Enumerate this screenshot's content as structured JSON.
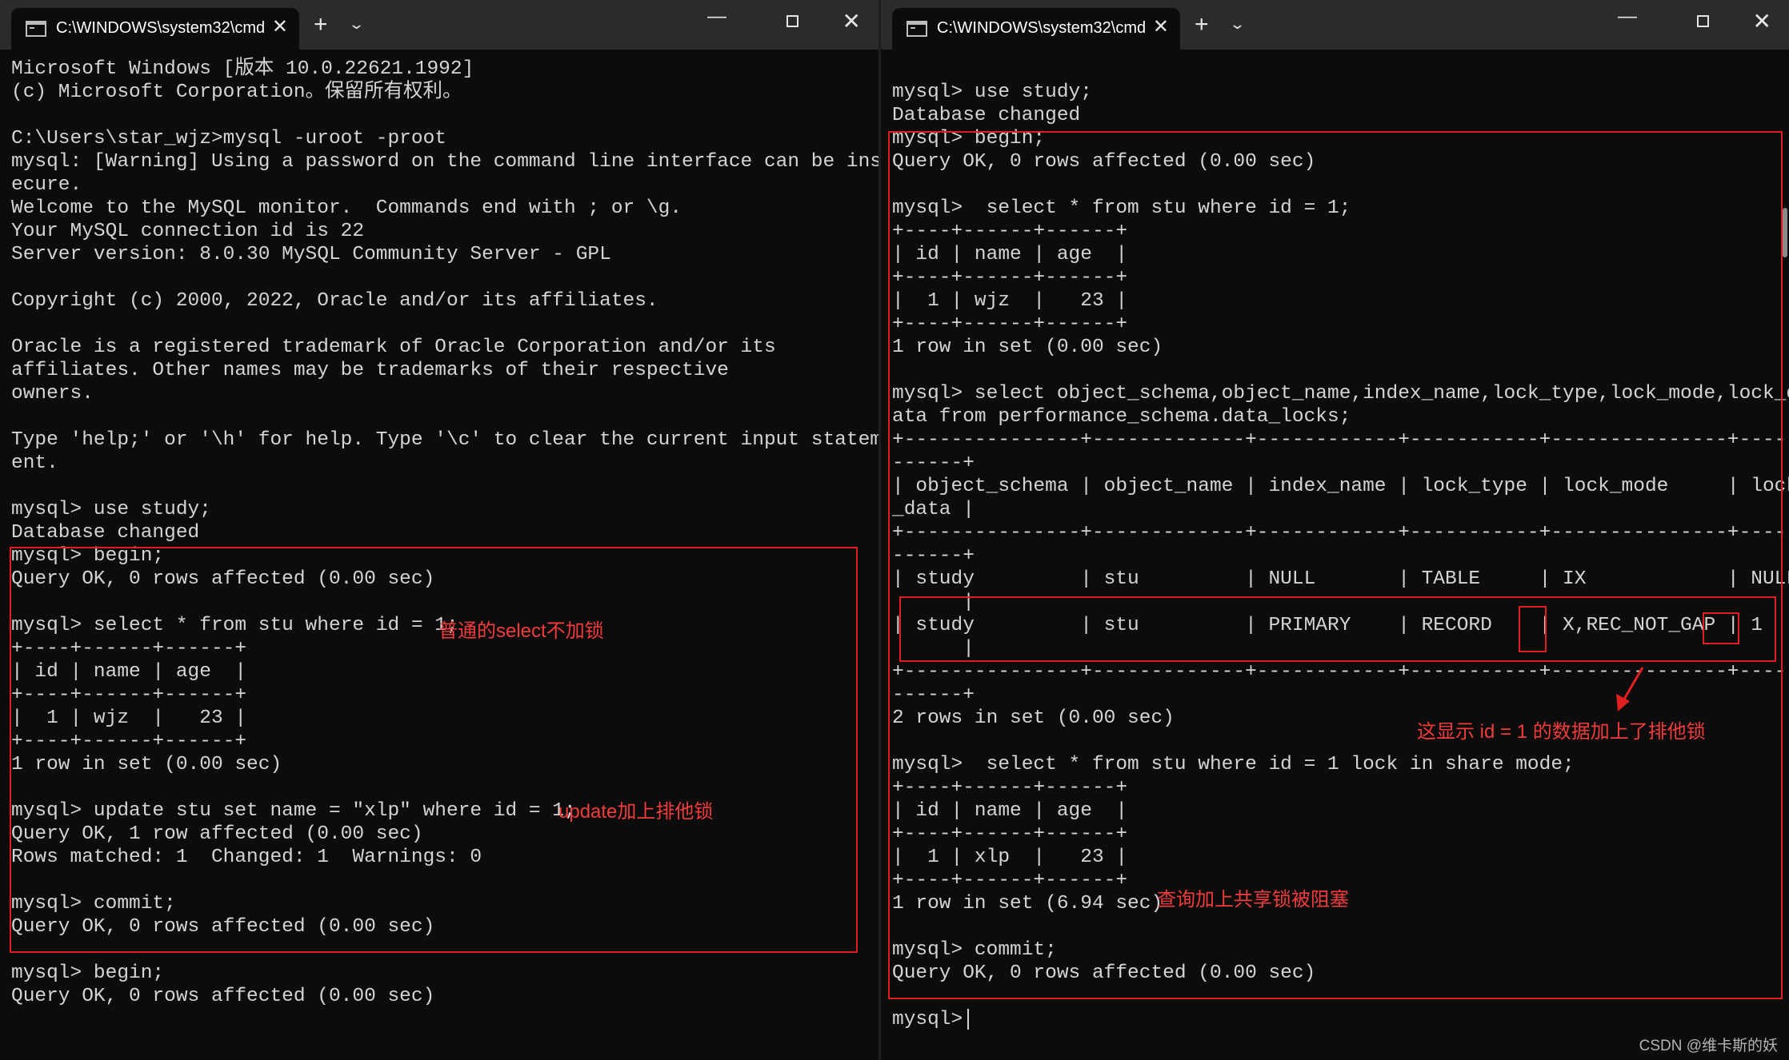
{
  "left_window": {
    "tab_title": "C:\\WINDOWS\\system32\\cmd.",
    "lines": [
      "Microsoft Windows [版本 10.0.22621.1992]",
      "(c) Microsoft Corporation。保留所有权利。",
      "",
      "C:\\Users\\star_wjz>mysql -uroot -proot",
      "mysql: [Warning] Using a password on the command line interface can be ins",
      "ecure.",
      "Welcome to the MySQL monitor.  Commands end with ; or \\g.",
      "Your MySQL connection id is 22",
      "Server version: 8.0.30 MySQL Community Server - GPL",
      "",
      "Copyright (c) 2000, 2022, Oracle and/or its affiliates.",
      "",
      "Oracle is a registered trademark of Oracle Corporation and/or its",
      "affiliates. Other names may be trademarks of their respective",
      "owners.",
      "",
      "Type 'help;' or '\\h' for help. Type '\\c' to clear the current input statem",
      "ent.",
      "",
      "mysql> use study;",
      "Database changed",
      "mysql> begin;",
      "Query OK, 0 rows affected (0.00 sec)",
      "",
      "mysql> select * from stu where id = 1;",
      "+----+------+------+",
      "| id | name | age  |",
      "+----+------+------+",
      "|  1 | wjz  |   23 |",
      "+----+------+------+",
      "1 row in set (0.00 sec)",
      "",
      "mysql> update stu set name = \"xlp\" where id = 1;",
      "Query OK, 1 row affected (0.00 sec)",
      "Rows matched: 1  Changed: 1  Warnings: 0",
      "",
      "mysql> commit;",
      "Query OK, 0 rows affected (0.00 sec)",
      "",
      "mysql> begin;",
      "Query OK, 0 rows affected (0.00 sec)"
    ],
    "annotations": {
      "select_note": "普通的select不加锁",
      "update_note": "update加上排他锁"
    }
  },
  "right_window": {
    "tab_title": "C:\\WINDOWS\\system32\\cmd.",
    "lines": [
      "mysql> use study;",
      "Database changed",
      "mysql> begin;",
      "Query OK, 0 rows affected (0.00 sec)",
      "",
      "mysql>  select * from stu where id = 1;",
      "+----+------+------+",
      "| id | name | age  |",
      "+----+------+------+",
      "|  1 | wjz  |   23 |",
      "+----+------+------+",
      "1 row in set (0.00 sec)",
      "",
      "mysql> select object_schema,object_name,index_name,lock_type,lock_mode,lock_d",
      "ata from performance_schema.data_locks;",
      "+---------------+-------------+------------+-----------+---------------+-----",
      "------+",
      "| object_schema | object_name | index_name | lock_type | lock_mode     | lock",
      "_data |",
      "+---------------+-------------+------------+-----------+---------------+-----",
      "------+",
      "| study         | stu         | NULL       | TABLE     | IX            | NULL",
      "      |",
      "| study         | stu         | PRIMARY    | RECORD    | X,REC_NOT_GAP | 1",
      "      |",
      "+---------------+-------------+------------+-----------+---------------+-----",
      "------+",
      "2 rows in set (0.00 sec)",
      "",
      "mysql>  select * from stu where id = 1 lock in share mode;",
      "+----+------+------+",
      "| id | name | age  |",
      "+----+------+------+",
      "|  1 | xlp  |   23 |",
      "+----+------+------+",
      "1 row in set (6.94 sec)",
      "",
      "mysql> commit;",
      "Query OK, 0 rows affected (0.00 sec)",
      "",
      "mysql> "
    ],
    "annotations": {
      "lock_note": "这显示 id = 1 的数据加上了排他锁",
      "share_note": "查询加上共享锁被阻塞"
    }
  },
  "watermark": "CSDN @维卡斯的妖",
  "icons": {
    "tab_icon": "terminal-icon",
    "new_tab": "+",
    "dropdown": "⌄",
    "close": "✕",
    "minimize": "—"
  },
  "colors": {
    "background": "#0c0c0c",
    "text": "#d4d4d4",
    "annotation": "#f23b3b",
    "titlebar": "#2b2b2b"
  }
}
